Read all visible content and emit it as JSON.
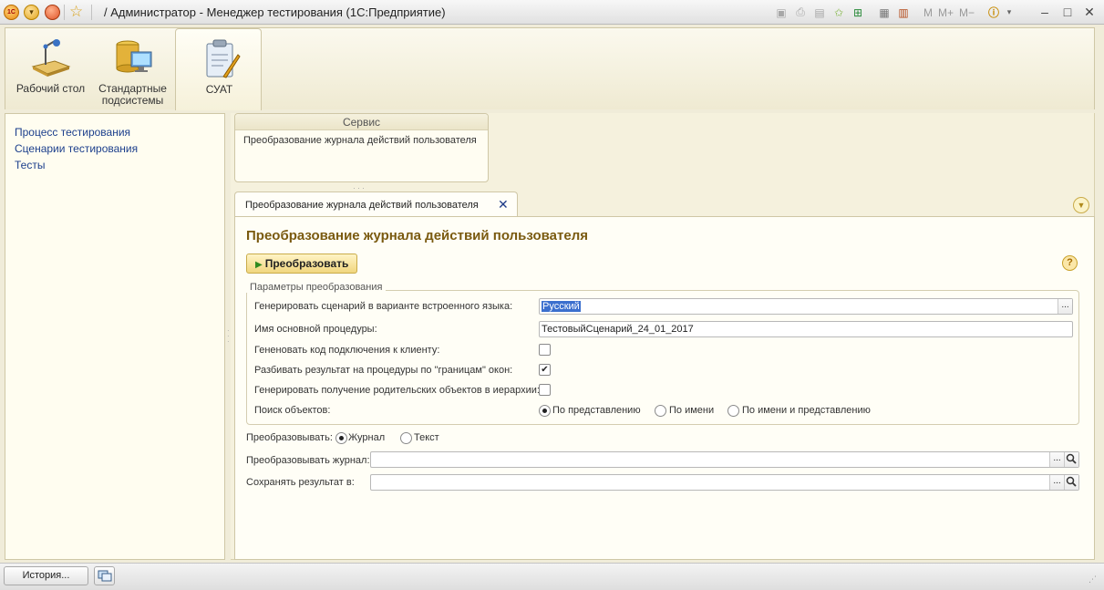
{
  "titlebar": {
    "title": "/ Администратор  - Менеджер тестирования (1С:Предприятие)",
    "logo_text": "1C",
    "tools_right": [
      "M",
      "M+",
      "M−"
    ],
    "icons": [
      "save-icon",
      "print-icon",
      "preview-icon",
      "favorite-icon",
      "bookmark-icon",
      "calculator-icon",
      "calendar-icon",
      "info-icon"
    ]
  },
  "sections": [
    {
      "label": "Рабочий стол",
      "icon": "desktop-icon"
    },
    {
      "label": "Стандартные подсистемы",
      "icon": "database-icon"
    },
    {
      "label": "СУАТ",
      "icon": "clipboard-icon"
    }
  ],
  "nav": {
    "items": [
      "Процесс тестирования",
      "Сценарии тестирования",
      "Тесты"
    ]
  },
  "service": {
    "header": "Сервис",
    "item": "Преобразование журнала действий пользователя"
  },
  "tab": {
    "label": "Преобразование журнала действий пользователя",
    "close": "✕"
  },
  "form": {
    "title": "Преобразование журнала действий пользователя",
    "run_button": "Преобразовать",
    "help": "?",
    "group_title": "Параметры преобразования",
    "fields": {
      "language_label": "Генерировать сценарий в варианте встроенного языка:",
      "language_value": "Русский",
      "procedure_label": "Имя основной процедуры:",
      "procedure_value": "ТестовыйСценарий_24_01_2017",
      "connect_code_label": "Гененовать код подключения к клиенту:",
      "connect_code_checked": false,
      "split_label": "Разбивать результат на процедуры по \"границам\" окон:",
      "split_checked": true,
      "parents_label": "Генерировать получение родительских объектов в иерархии:",
      "parents_checked": false,
      "search_label": "Поиск объектов:",
      "search_options": [
        "По представлению",
        "По имени",
        "По имени и представлению"
      ],
      "search_selected": "По представлению"
    },
    "convert": {
      "label": "Преобразовывать:",
      "options": [
        "Журнал",
        "Текст"
      ],
      "selected": "Журнал"
    },
    "journal_label": "Преобразовывать журнал:",
    "journal_value": "",
    "save_label": "Сохранять результат в:",
    "save_value": "",
    "dots": "..."
  },
  "statusbar": {
    "history_button": "История..."
  }
}
